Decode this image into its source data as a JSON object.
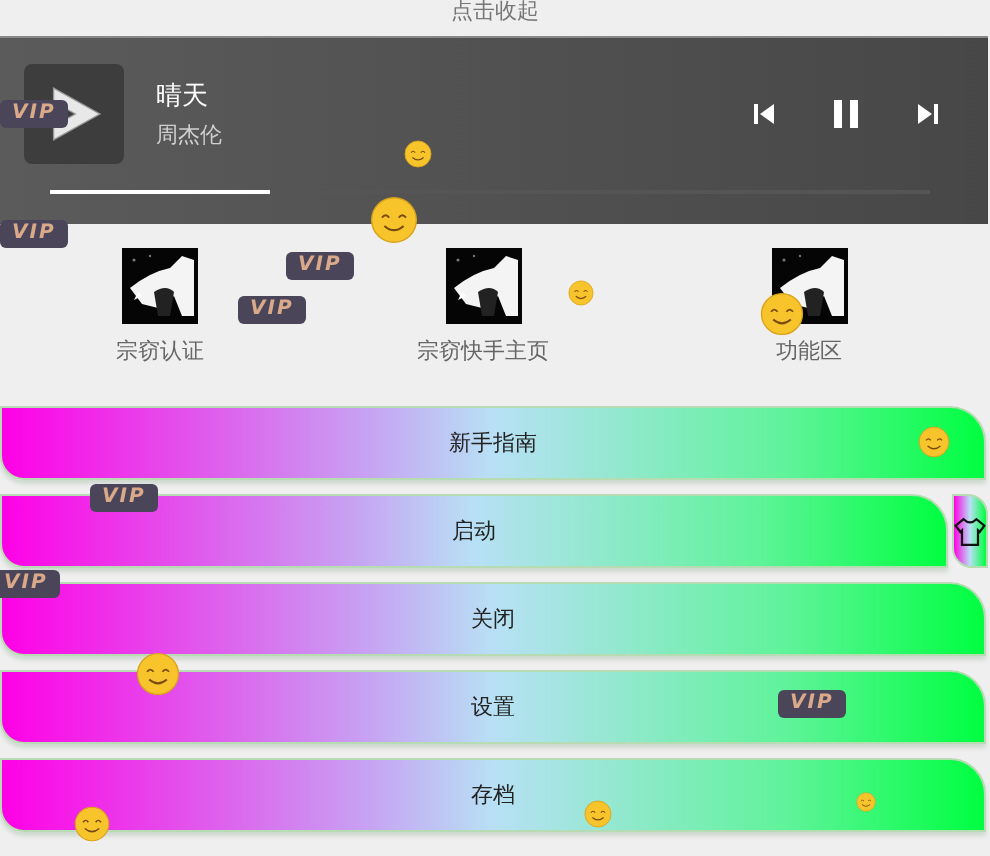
{
  "collapse_hint": "点击收起",
  "player": {
    "title": "晴天",
    "artist": "周杰伦",
    "playing": true,
    "level": 0.25
  },
  "shortcuts": [
    {
      "label": "宗窃认证"
    },
    {
      "label": "宗窃快手主页"
    },
    {
      "label": "功能区"
    }
  ],
  "menu": [
    {
      "label": "新手指南"
    },
    {
      "label": "启动"
    },
    {
      "label": "关闭"
    },
    {
      "label": "设置"
    },
    {
      "label": "存档"
    }
  ],
  "vip_badges": [
    "VIP",
    "VIP",
    "VIP",
    "VIP",
    "VIP",
    "VIP",
    "VIP"
  ]
}
